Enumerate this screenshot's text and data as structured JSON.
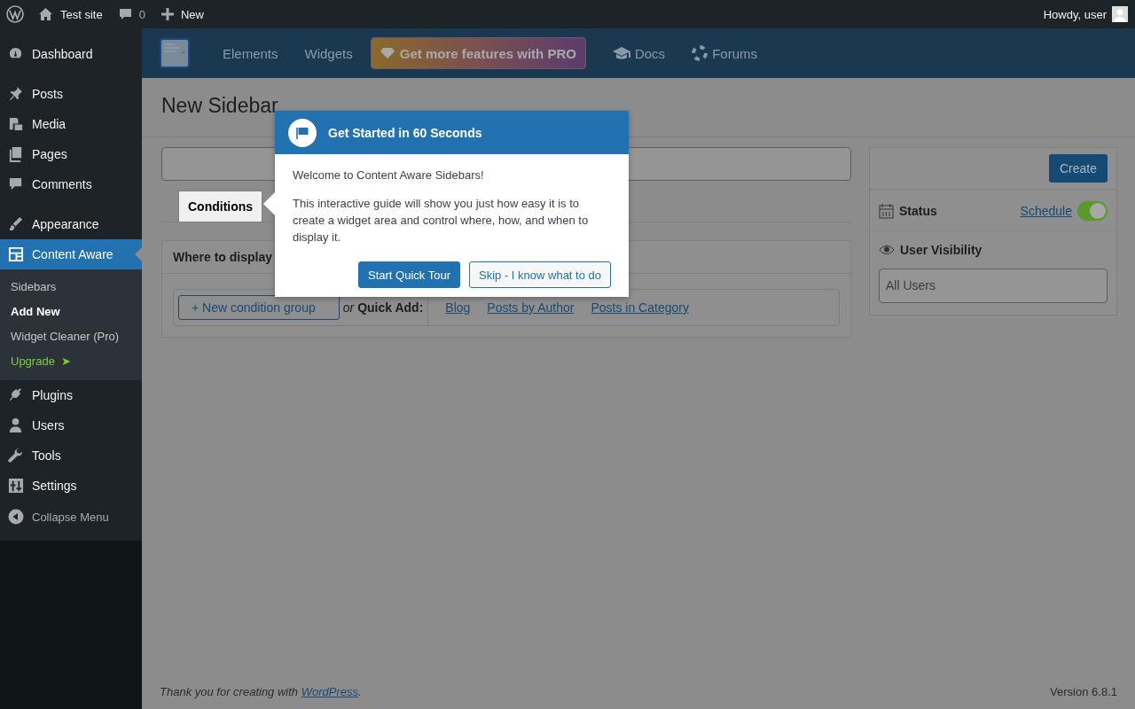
{
  "admin_bar": {
    "site": "Test site",
    "comments": "0",
    "new": "New",
    "greeting": "Howdy, user"
  },
  "menu_groups": [
    [
      {
        "label": "Dashboard",
        "selected": false
      }
    ],
    [
      {
        "label": "Posts",
        "selected": false
      },
      {
        "label": "Media",
        "selected": false
      },
      {
        "label": "Pages",
        "selected": false
      },
      {
        "label": "Comments",
        "selected": false
      }
    ],
    [
      {
        "label": "Appearance",
        "selected": false
      },
      {
        "label": "Content Aware",
        "selected": true,
        "children": [
          {
            "label": "Sidebars",
            "selected": false,
            "kind": "plain"
          },
          {
            "label": "Add New",
            "selected": true,
            "kind": "plain"
          },
          {
            "label": "Widget Cleaner (Pro)",
            "selected": false,
            "kind": "plain"
          },
          {
            "label": "Upgrade",
            "arrow": "➤",
            "selected": false,
            "kind": "upgrade"
          }
        ]
      },
      {
        "label": "Plugins",
        "selected": false
      },
      {
        "label": "Users",
        "selected": false
      },
      {
        "label": "Tools",
        "selected": false
      },
      {
        "label": "Settings",
        "selected": false
      }
    ]
  ],
  "collapse": "Collapse Menu",
  "header": {
    "tabs": [
      "Elements",
      "Widgets"
    ],
    "pro": "Get more features with PRO",
    "links": [
      "Docs",
      "Forums"
    ]
  },
  "page": {
    "title": "New Sidebar",
    "tabs": [
      {
        "label": "Conditions",
        "selected": true
      }
    ],
    "box_title": "Where to display",
    "new_group": "+ New condition group",
    "or": "or",
    "quick_add": "Quick Add:",
    "quick_links": [
      "Blog",
      "Posts by Author",
      "Posts in Category"
    ]
  },
  "side": {
    "create": "Create",
    "status": "Status",
    "schedule": "Schedule",
    "status_on": true,
    "visibility": "User Visibility",
    "visibility_value": "All Users"
  },
  "footer": {
    "before": "Thank you for creating with ",
    "link": "WordPress",
    "after": ".",
    "version": "Version 6.8.1"
  },
  "popup": {
    "title": "Get Started in 60 Seconds",
    "paragraphs": [
      "Welcome to Content Aware Sidebars!",
      "This interactive guide will show you just how easy it is to create a widget area and control where, how, and when to display it."
    ],
    "primary": "Start Quick Tour",
    "secondary": "Skip - I know what to do"
  }
}
